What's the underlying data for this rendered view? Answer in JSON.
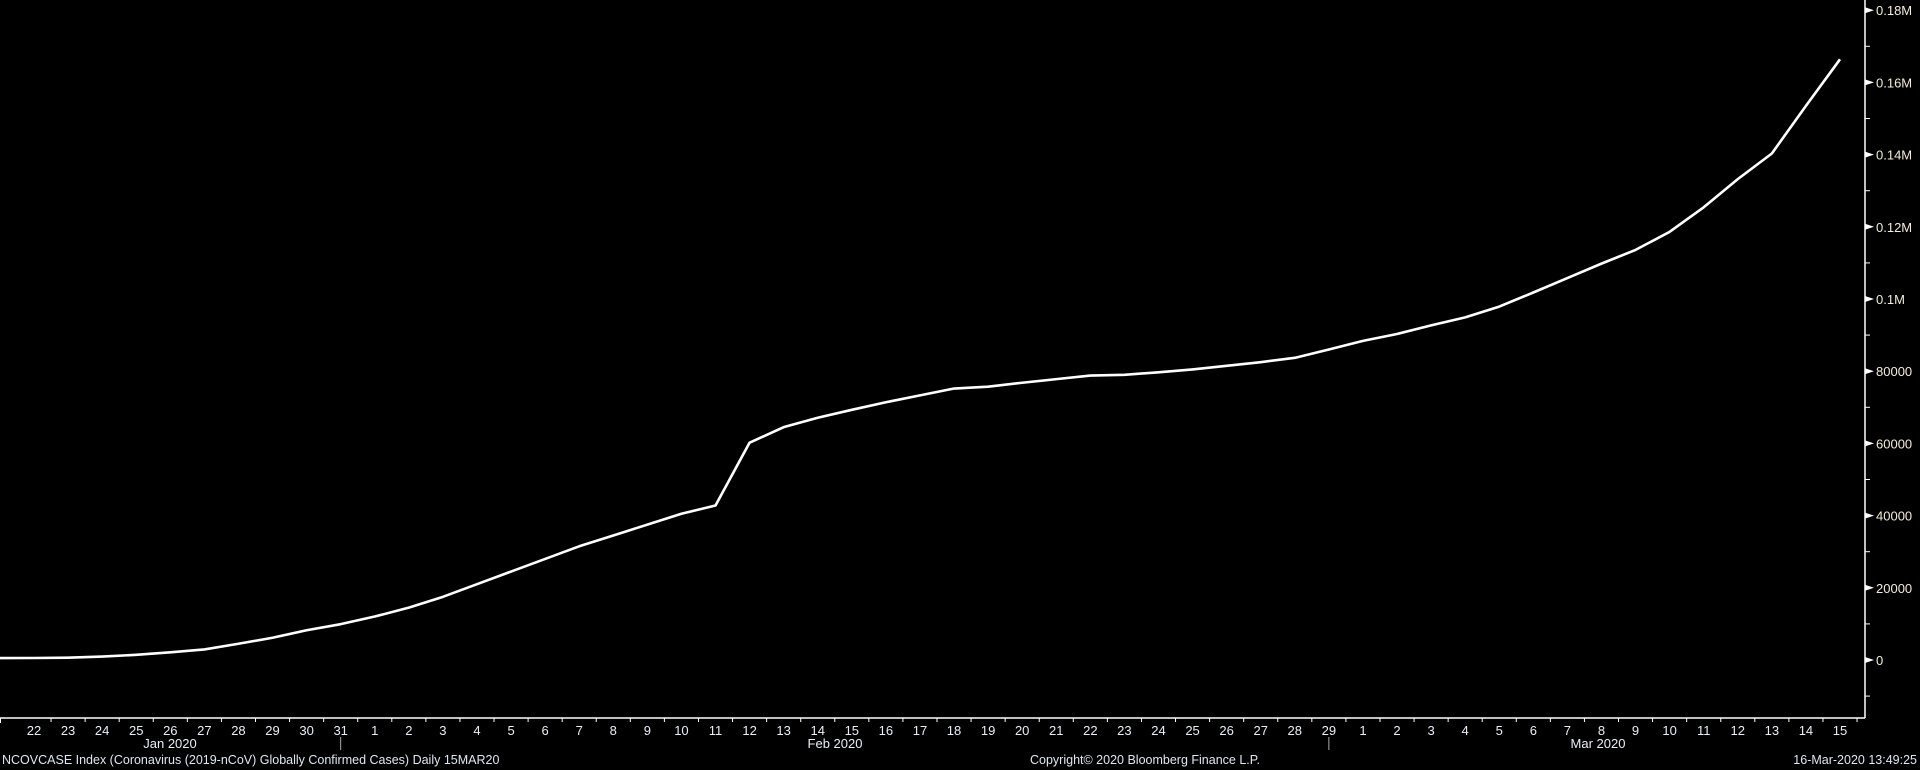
{
  "chart_data": {
    "type": "line",
    "title": "NCOVCASE Index (Coronavirus (2019-nCoV) Globally Confirmed Cases)  Daily 15MAR20",
    "series": [
      {
        "name": "NCOVCASE Index",
        "color": "#ffffff"
      }
    ],
    "x_tick_labels": [
      "22",
      "23",
      "24",
      "25",
      "26",
      "27",
      "28",
      "29",
      "30",
      "31",
      "1",
      "2",
      "3",
      "4",
      "5",
      "6",
      "7",
      "8",
      "9",
      "10",
      "11",
      "12",
      "13",
      "14",
      "15",
      "16",
      "17",
      "18",
      "19",
      "20",
      "21",
      "22",
      "23",
      "24",
      "25",
      "26",
      "27",
      "28",
      "29",
      "1",
      "2",
      "3",
      "4",
      "5",
      "6",
      "7",
      "8",
      "9",
      "10",
      "11",
      "12",
      "13",
      "14",
      "15"
    ],
    "values": [
      555,
      654,
      941,
      1434,
      2118,
      2927,
      4500,
      6166,
      8234,
      9927,
      12038,
      14500,
      17500,
      21000,
      24500,
      28000,
      31500,
      34500,
      37500,
      40500,
      42800,
      60200,
      64500,
      67100,
      69300,
      71400,
      73300,
      75200,
      75700,
      76800,
      77800,
      78800,
      79000,
      79700,
      80500,
      81500,
      82500,
      83700,
      86000,
      88400,
      90300,
      92700,
      94900,
      97900,
      101800,
      105800,
      109800,
      113600,
      118600,
      125400,
      133200,
      140300,
      153500,
      166400
    ],
    "month_labels": [
      "Jan 2020",
      "Feb 2020",
      "Mar 2020"
    ],
    "y_tick_labels": [
      "0",
      "20000",
      "40000",
      "60000",
      "80000",
      "0.1M",
      "0.12M",
      "0.14M",
      "0.16M",
      "0.18M"
    ],
    "ylim": [
      -10000,
      180000
    ],
    "xlabel": "",
    "ylabel": "",
    "grid": false
  },
  "footer": {
    "description": "NCOVCASE Index (Coronavirus (2019-nCoV) Globally Confirmed Cases)  Daily 15MAR20",
    "copyright": "Copyright© 2020 Bloomberg Finance L.P.",
    "timestamp": "16-Mar-2020 13:49:25"
  }
}
